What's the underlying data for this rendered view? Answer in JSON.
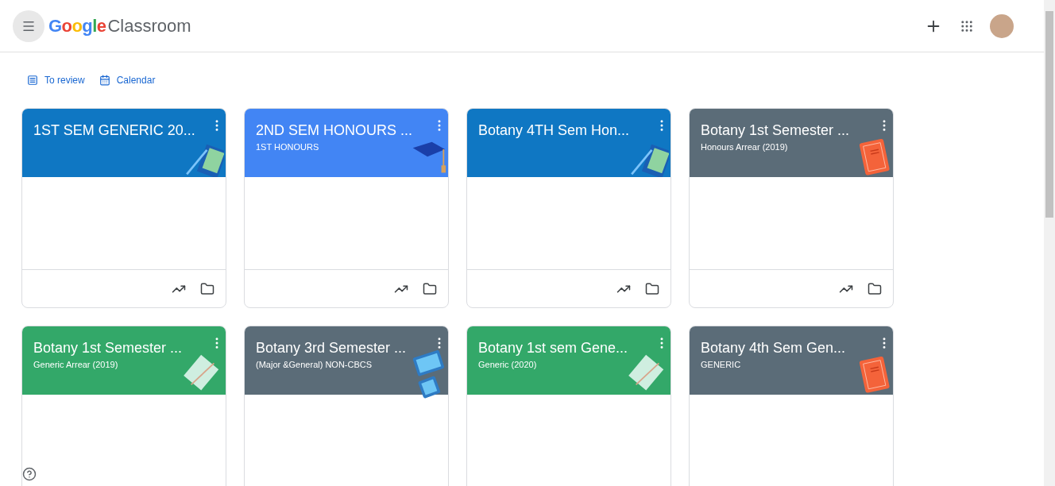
{
  "header": {
    "logo": "Google",
    "product": "Classroom"
  },
  "nav_links": [
    {
      "label": "To review",
      "kind": "review"
    },
    {
      "label": "Calendar",
      "kind": "calendar"
    }
  ],
  "classes": [
    {
      "title": "1ST SEM GENERIC 20...",
      "color": "#0f77c3",
      "kind": "pencil"
    },
    {
      "title": "2ND SEM HONOURS ...",
      "subtitle": "1ST HONOURS",
      "color": "#4285f4",
      "kind": "cap"
    },
    {
      "title": "Botany 4TH Sem Hon...",
      "color": "#0f77c3",
      "kind": "pencil"
    },
    {
      "title": "Botany 1st Semester ...",
      "subtitle": "Honours Arrear (2019)",
      "color": "#5b6c78",
      "kind": "book"
    },
    {
      "title": "Botany 1st Semester ...",
      "subtitle": "Generic Arrear (2019)",
      "color": "#33a869",
      "kind": "notebook"
    },
    {
      "title": "Botany 3rd Semester ...",
      "subtitle": "(Major &General) NON-CBCS",
      "color": "#5b6c78",
      "kind": "tablet"
    },
    {
      "title": "Botany 1st sem Gene...",
      "subtitle": "Generic (2020)",
      "color": "#33a869",
      "kind": "notebook"
    },
    {
      "title": "Botany 4th Sem Gen...",
      "subtitle": "GENERIC",
      "color": "#5b6c78",
      "kind": "book"
    }
  ]
}
